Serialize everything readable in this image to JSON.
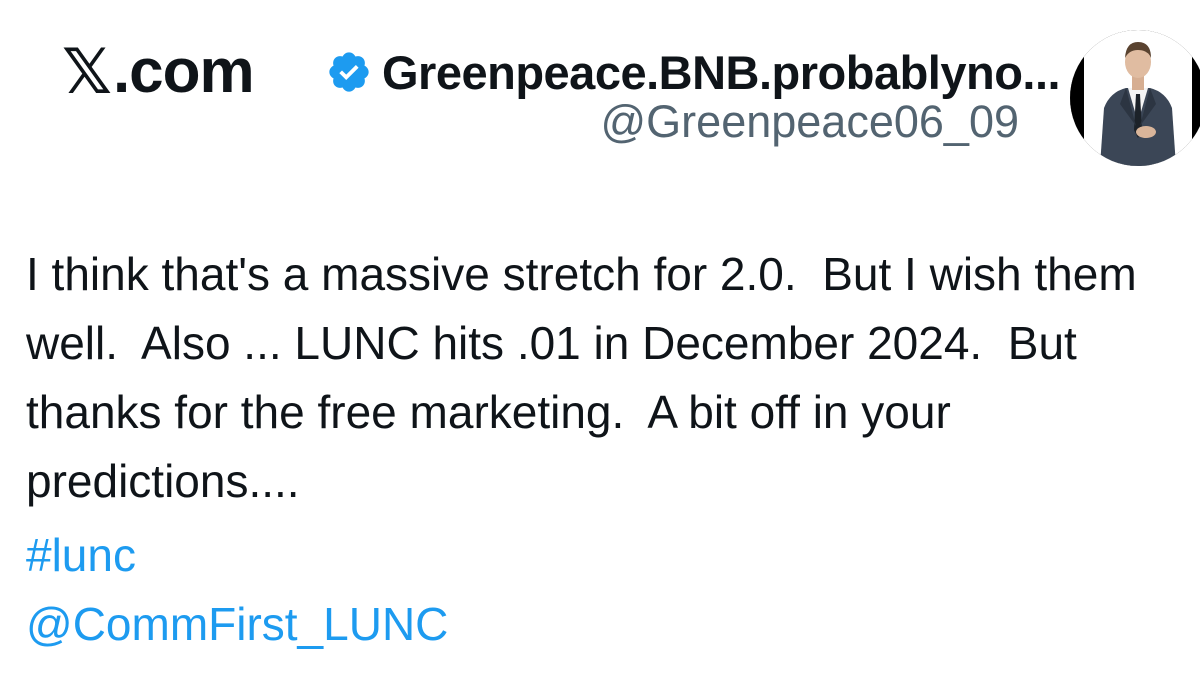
{
  "header": {
    "site_logo_x": "𝕏",
    "site_logo_domain": ".com"
  },
  "author": {
    "display_name": "Greenpeace.BNB.probablyno...",
    "handle": "@Greenpeace06_09",
    "verified": true,
    "verified_color": "#1d9bf0",
    "avatar_icon": "profile-photo-man-in-suit"
  },
  "tweet": {
    "text": "I think that's a massive stretch for 2.0.  But I wish them well.  Also ... LUNC hits .01 in December 2024.  But thanks for the free marketing.  A bit off in your predictions....",
    "hashtag": "#lunc",
    "mention": "@CommFirst_LUNC",
    "link_color": "#1d9bf0"
  }
}
